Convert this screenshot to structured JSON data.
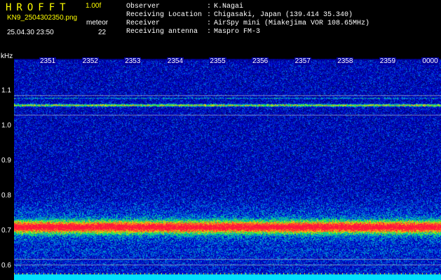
{
  "header": {
    "app_title": "HROFFT",
    "version": "1.00f",
    "filename": "KN9_2504302350.png",
    "meteor_label": "meteor",
    "datetime": "25.04.30 23:50",
    "meteor_count": "22"
  },
  "info": [
    {
      "label": "Observer",
      "value": "K.Nagai"
    },
    {
      "label": "Receiving Location",
      "value": "Chigasaki, Japan (139.414 35.340)"
    },
    {
      "label": "Receiver",
      "value": "AirSpy mini (Miakejima VOR 108.65MHz)"
    },
    {
      "label": "Receiving antenna",
      "value": "Maspro FM-3"
    }
  ],
  "axis": {
    "y_unit": "kHz",
    "y_ticks": [
      "1.1",
      "1.0",
      "0.9",
      "0.8",
      "0.7",
      "0.6"
    ],
    "x_ticks": [
      "2351",
      "2352",
      "2353",
      "2354",
      "2355",
      "2356",
      "2357",
      "2358",
      "2359",
      "0000"
    ]
  },
  "colors": {
    "background": "#000000",
    "header_title": "#ffff00",
    "header_text": "#ffffff",
    "waterfall_base": "#00008c"
  }
}
